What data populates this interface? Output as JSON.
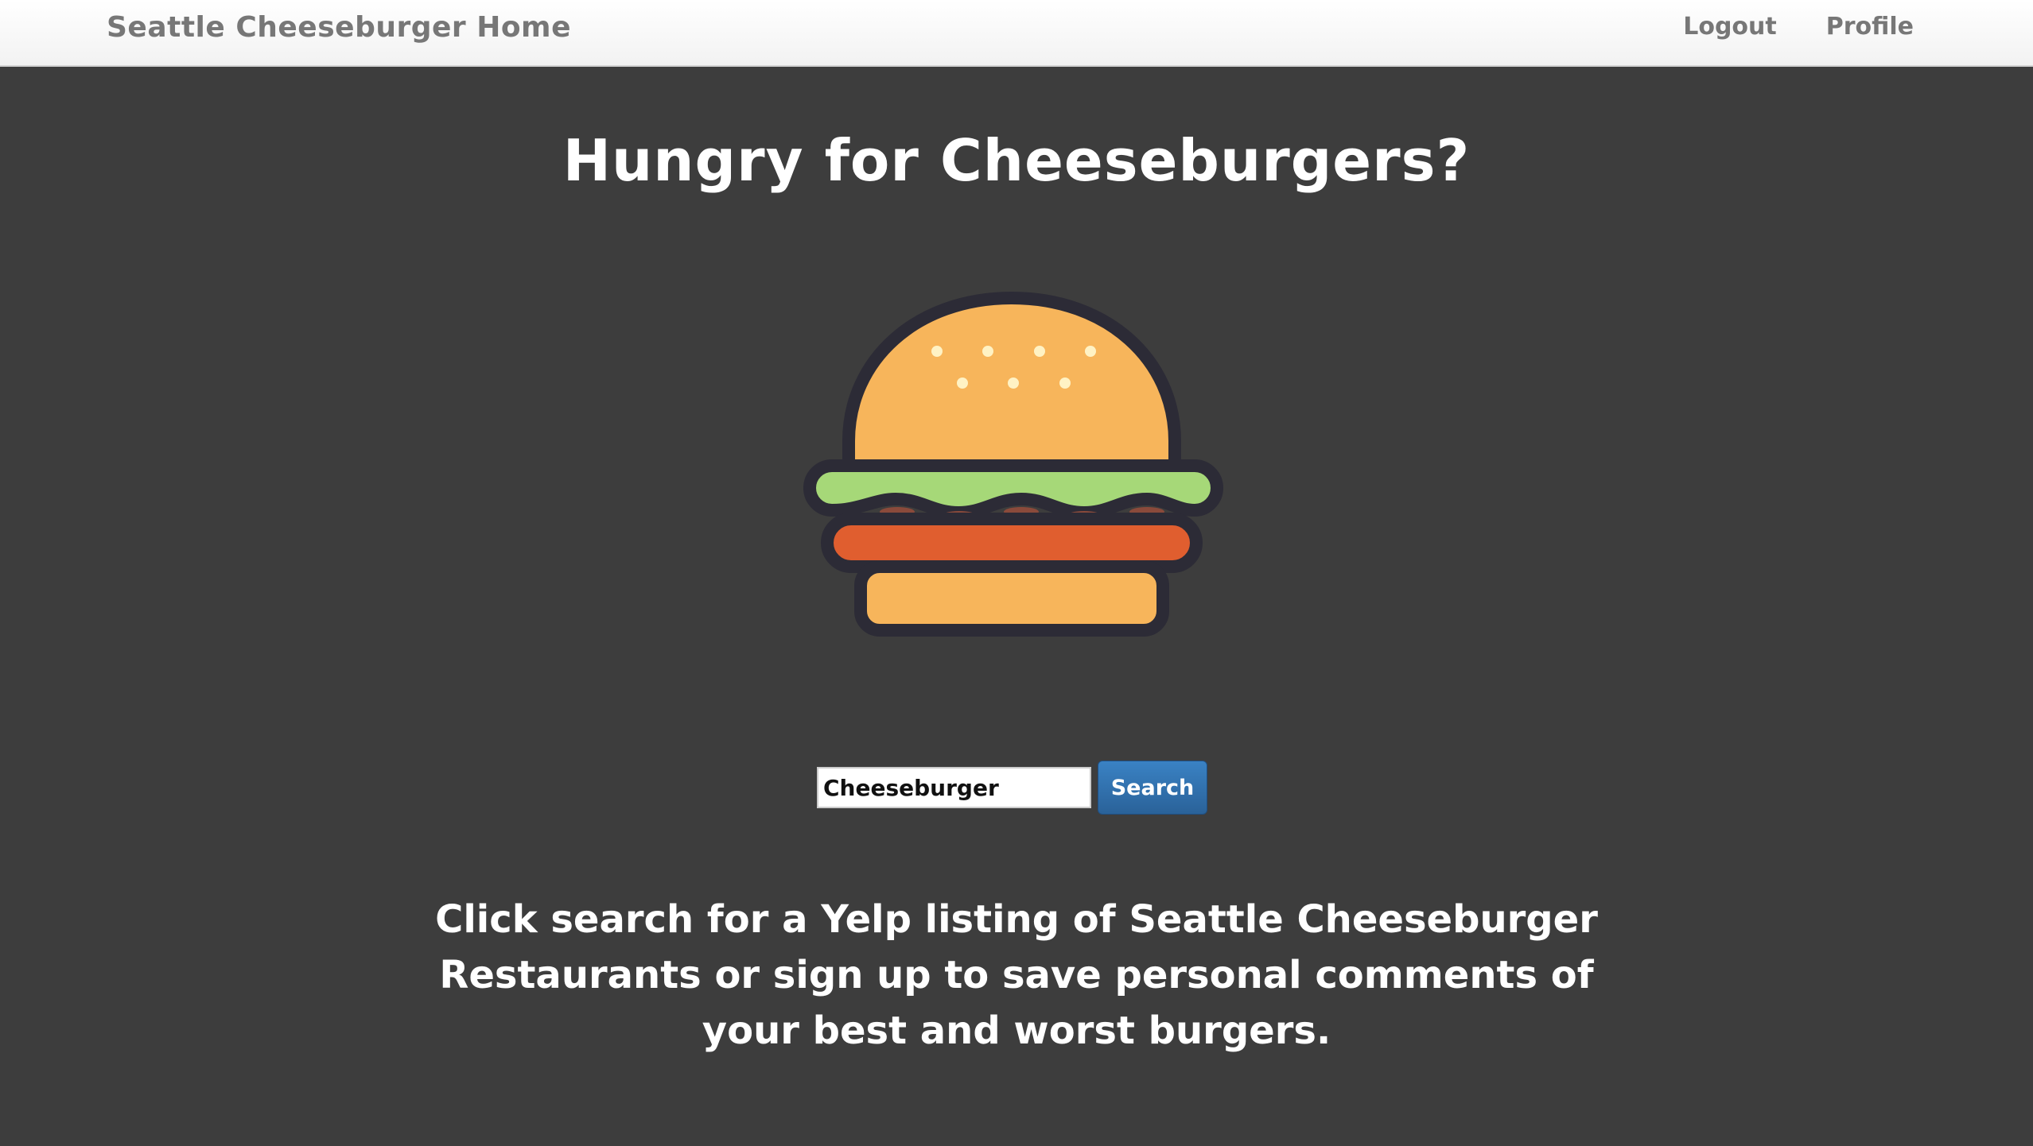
{
  "navbar": {
    "brand": "Seattle Cheeseburger Home",
    "links": [
      {
        "label": "Logout"
      },
      {
        "label": "Profile"
      }
    ]
  },
  "main": {
    "headline": "Hungry for Cheeseburgers?",
    "illustration_icon": "cheeseburger-icon",
    "search": {
      "value": "Cheeseburger",
      "button_label": "Search"
    },
    "tagline": "Click search for a Yelp listing of Seattle Cheeseburger Restaurants or sign up to save personal comments of your best and worst burgers."
  },
  "colors": {
    "background": "#3d3d3d",
    "navbar": "#f8f8f8",
    "nav_text": "#777777",
    "button": "#2f6fac",
    "bun": "#f7b55b",
    "lettuce": "#a6d878",
    "patty": "#e05e2f",
    "outline": "#2c2b36"
  }
}
